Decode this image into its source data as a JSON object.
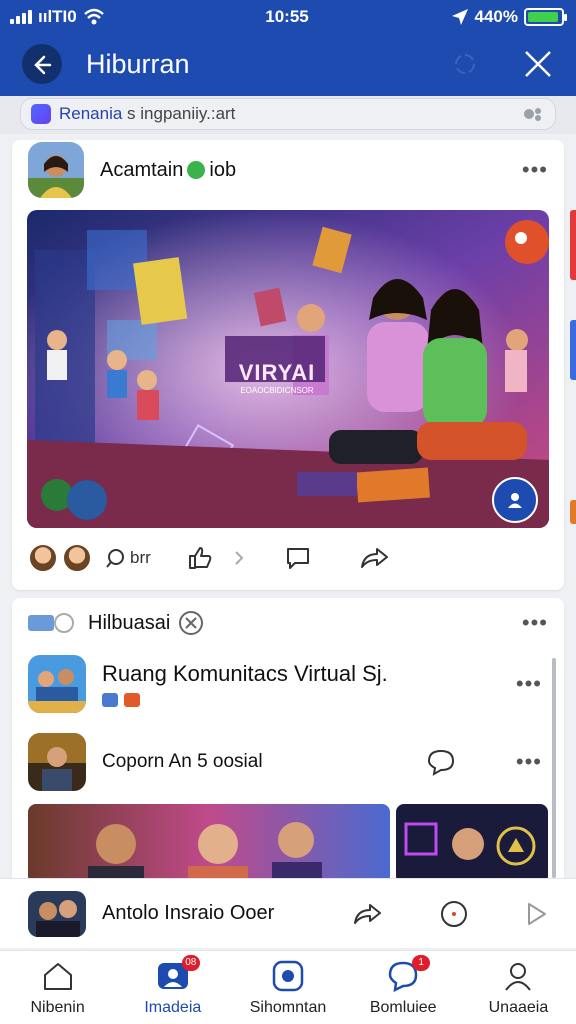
{
  "status": {
    "time": "10:55",
    "carrier": "ıılTI0",
    "battery": "440%",
    "battery_level": 0.95
  },
  "header": {
    "title": "Hiburran"
  },
  "search": {
    "text_accent": "Renania",
    "text_rest": " s ingpaniiy.:art"
  },
  "post": {
    "author": "Acamtain",
    "author_suffix": "iob",
    "image_badge": "VIRYAI",
    "image_badge_sub": "EOAOCBIDICNSOR",
    "comment_label": "brr"
  },
  "feed": {
    "title": "Hilbuasai",
    "items": [
      {
        "title": "Ruang Komunitacs Virtual Sj."
      },
      {
        "title": "Coporn An 5 oosial"
      }
    ]
  },
  "player": {
    "title": "Antolo Insraio Ooer"
  },
  "tabs": [
    {
      "label": "Nibenin",
      "badge": ""
    },
    {
      "label": "Imadeia",
      "badge": "08"
    },
    {
      "label": "Sihomntan",
      "badge": ""
    },
    {
      "label": "Bomluiee",
      "badge": "1"
    },
    {
      "label": "Unaaeia",
      "badge": ""
    }
  ],
  "colors": {
    "header": "#1d4bb0",
    "active_tab": "#1d4bb0",
    "badge": "#e11c2b"
  }
}
